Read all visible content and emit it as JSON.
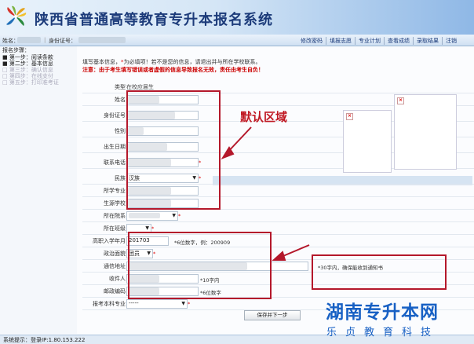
{
  "app": {
    "title": "陕西省普通高等教育专升本报名系统",
    "name_label": "姓名：",
    "id_label": "身份证号：",
    "nav_links": [
      "修改密码",
      "填报志愿",
      "专业计划",
      "查看成绩",
      "录取结果",
      "注销"
    ]
  },
  "steps": {
    "title": "报名步骤：",
    "items": [
      {
        "label": "■ 第一步：阅读条款",
        "state": "done"
      },
      {
        "label": "■ 第二步：基本信息",
        "state": "done"
      },
      {
        "label": "□ 第三步：确认信息",
        "state": "todo"
      },
      {
        "label": "□ 第四步：在线支付",
        "state": "todo"
      },
      {
        "label": "□ 第五步：打印准考证",
        "state": "todo"
      }
    ]
  },
  "notice": {
    "line1_a": "填写基本信息，",
    "line1_star": "*",
    "line1_b": "为必填项！若不是您的信息，请退出并与所在学校联系。",
    "line2": "注意：由于考生填写错误或者虚假的信息导致报名无效，责任由考生自负！"
  },
  "form": {
    "rows": [
      {
        "label": "类型",
        "value": "在校应届生"
      },
      {
        "label": "姓名",
        "value": ""
      },
      {
        "label": "身份证号",
        "value": ""
      },
      {
        "label": "性别",
        "value": ""
      },
      {
        "label": "出生日期",
        "value": ""
      },
      {
        "label": "联系电话",
        "value": ""
      },
      {
        "label": "民族",
        "value": "汉族"
      },
      {
        "label": "所学专业",
        "value": ""
      },
      {
        "label": "生源学校",
        "value": ""
      },
      {
        "label": "所在院系",
        "value": ""
      },
      {
        "label": "所在班级",
        "value": ""
      },
      {
        "label": "高职入学年月",
        "value": "201703",
        "hint": "*6位数字，例：200909"
      },
      {
        "label": "政治面貌",
        "value": "团员"
      },
      {
        "label": "通信地址",
        "value": "",
        "hint": "*30字内，确保能收到通知书"
      },
      {
        "label": "收件人",
        "value": "",
        "hint": "*10字内"
      },
      {
        "label": "邮政编码",
        "value": "",
        "hint": "*6位数字"
      },
      {
        "label": "报考本科专业",
        "value": "-----"
      }
    ],
    "required_star": "*",
    "submit_label": "保存并下一步"
  },
  "annotation": {
    "text": "默认区域"
  },
  "status": {
    "text": "系统提示：登录IP:1.80.153.222"
  },
  "watermark": {
    "line1": "湖南专升本网",
    "line2": "乐贞教育科技"
  },
  "colors": {
    "accent": "#1c3b7a",
    "annotation_red": "#b4182b",
    "watermark_blue": "#1760c4"
  }
}
